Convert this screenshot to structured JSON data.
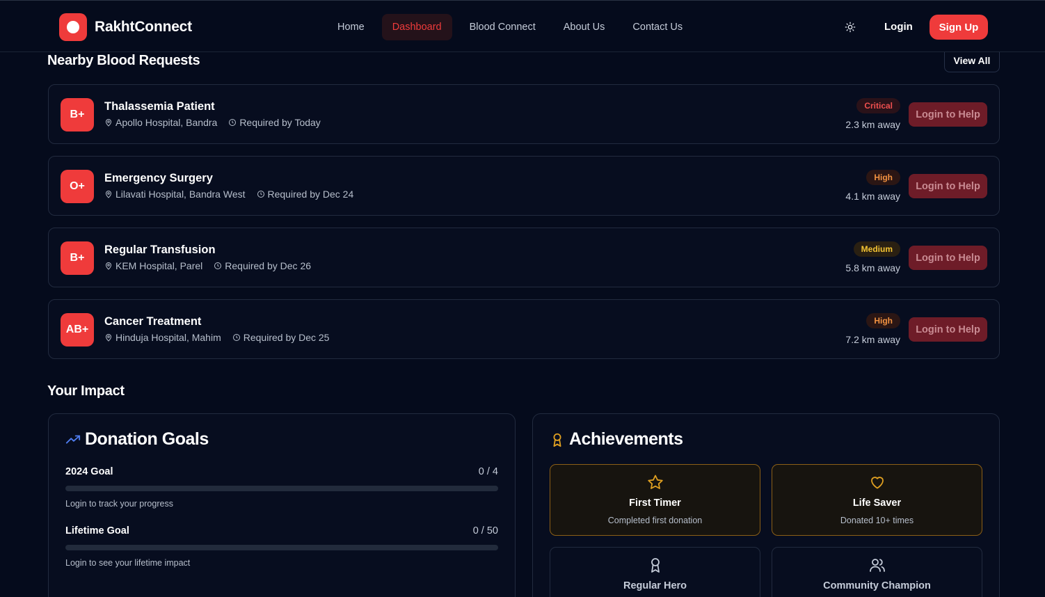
{
  "brand": {
    "name": "RakhtConnect"
  },
  "nav": {
    "links": [
      {
        "label": "Home",
        "active": false
      },
      {
        "label": "Dashboard",
        "active": true
      },
      {
        "label": "Blood Connect",
        "active": false
      },
      {
        "label": "About Us",
        "active": false
      },
      {
        "label": "Contact Us",
        "active": false
      }
    ],
    "theme_icon": "sun-icon",
    "login_label": "Login",
    "signup_label": "Sign Up"
  },
  "requests": {
    "title": "Nearby Blood Requests",
    "view_all_label": "View All",
    "items": [
      {
        "blood_type": "B+",
        "title": "Thalassemia Patient",
        "hospital": "Apollo Hospital, Bandra",
        "required": "Required by Today",
        "urgency": "Critical",
        "urgency_level": "critical",
        "distance": "2.3 km away",
        "action": "Login to Help"
      },
      {
        "blood_type": "O+",
        "title": "Emergency Surgery",
        "hospital": "Lilavati Hospital, Bandra West",
        "required": "Required by Dec 24",
        "urgency": "High",
        "urgency_level": "high",
        "distance": "4.1 km away",
        "action": "Login to Help"
      },
      {
        "blood_type": "B+",
        "title": "Regular Transfusion",
        "hospital": "KEM Hospital, Parel",
        "required": "Required by Dec 26",
        "urgency": "Medium",
        "urgency_level": "medium",
        "distance": "5.8 km away",
        "action": "Login to Help"
      },
      {
        "blood_type": "AB+",
        "title": "Cancer Treatment",
        "hospital": "Hinduja Hospital, Mahim",
        "required": "Required by Dec 25",
        "urgency": "High",
        "urgency_level": "high",
        "distance": "7.2 km away",
        "action": "Login to Help"
      }
    ]
  },
  "impact": {
    "title": "Your Impact",
    "goals": {
      "title": "Donation Goals",
      "icon": "trending-up-icon",
      "items": [
        {
          "label": "2024 Goal",
          "count": "0 / 4",
          "progress": 0,
          "hint": "Login to track your progress"
        },
        {
          "label": "Lifetime Goal",
          "count": "0 / 50",
          "progress": 0,
          "hint": "Login to see your lifetime impact"
        }
      ]
    },
    "achievements": {
      "title": "Achievements",
      "icon": "award-icon",
      "items": [
        {
          "name": "First Timer",
          "description": "Completed first donation",
          "icon": "star-icon",
          "earned": true
        },
        {
          "name": "Life Saver",
          "description": "Donated 10+ times",
          "icon": "heart-icon",
          "earned": true
        },
        {
          "name": "Regular Hero",
          "description": "",
          "icon": "award-icon",
          "earned": false
        },
        {
          "name": "Community Champion",
          "description": "",
          "icon": "users-icon",
          "earned": false
        }
      ]
    }
  },
  "colors": {
    "accent": "#ef3b3b",
    "background": "#050b1c",
    "critical": "#f0504f",
    "high": "#f29241",
    "medium": "#f4c433",
    "achievement_gold": "#e0a021"
  }
}
